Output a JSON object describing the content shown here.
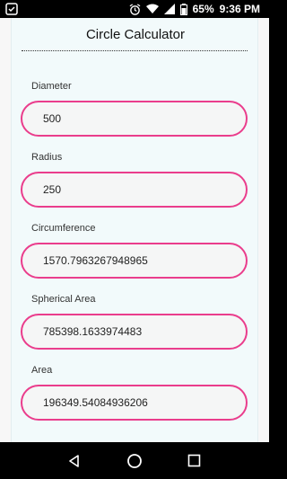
{
  "status_bar": {
    "battery_percent": "65%",
    "time": "9:36 PM"
  },
  "app": {
    "title": "Circle Calculator",
    "fields": [
      {
        "label": "Diameter",
        "value": "500"
      },
      {
        "label": "Radius",
        "value": "250"
      },
      {
        "label": "Circumference",
        "value": "1570.7963267948965"
      },
      {
        "label": "Spherical Area",
        "value": "785398.1633974483"
      },
      {
        "label": "Area",
        "value": "196349.54084936206"
      }
    ]
  },
  "colors": {
    "field_border": "#ea3d8c",
    "card_background": "#f2fafb"
  }
}
